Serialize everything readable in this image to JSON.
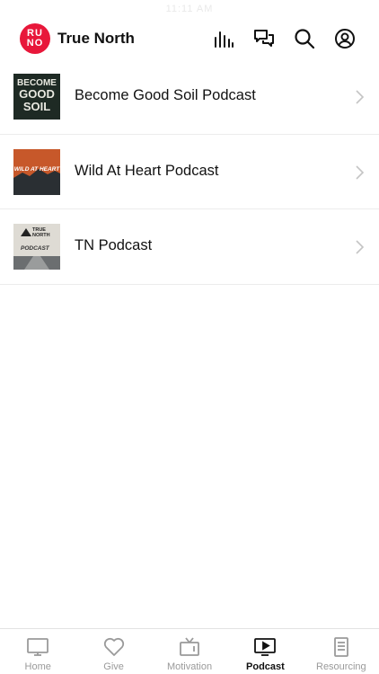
{
  "status": {
    "text": "11:11 AM"
  },
  "header": {
    "logo_lines": [
      "RU",
      "NO"
    ],
    "title": "True North"
  },
  "podcasts": [
    {
      "label": "Become Good Soil Podcast",
      "art_lines": [
        "BECOME",
        "GOOD",
        "SOIL"
      ]
    },
    {
      "label": "Wild At Heart Podcast",
      "art_lines": [
        "WILD AT HEART"
      ]
    },
    {
      "label": "TN Podcast",
      "art_lines": [
        "TRUE",
        "NORTH",
        "PODCAST"
      ]
    }
  ],
  "tabs": [
    {
      "label": "Home",
      "icon": "monitor-icon"
    },
    {
      "label": "Give",
      "icon": "heart-icon"
    },
    {
      "label": "Motivation",
      "icon": "tv-icon"
    },
    {
      "label": "Podcast",
      "icon": "play-screen-icon",
      "active": true
    },
    {
      "label": "Resourcing",
      "icon": "book-icon"
    }
  ],
  "colors": {
    "brand": "#e8173a",
    "active_tab": "#111111",
    "inactive_tab": "#9a9a9a"
  }
}
